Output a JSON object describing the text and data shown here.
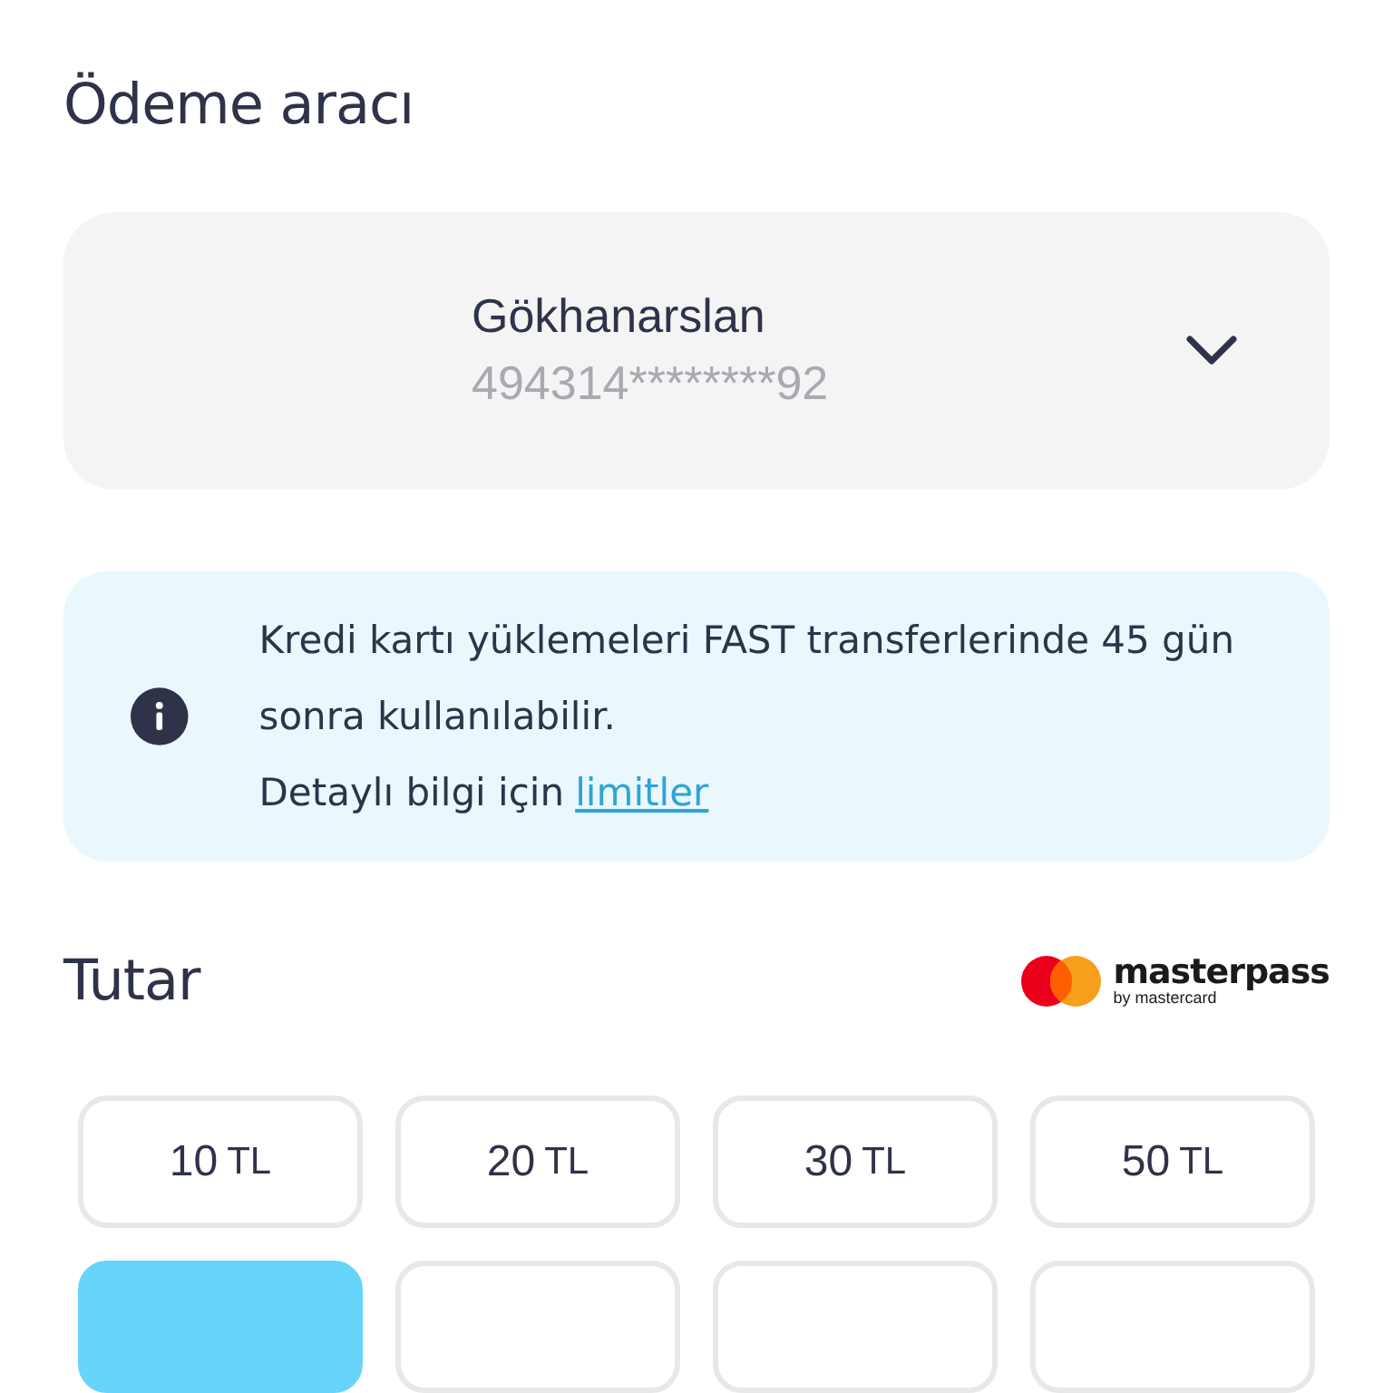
{
  "payment_method": {
    "title": "Ödeme aracı",
    "card": {
      "holder": "Gökhanarslan",
      "number": "494314********92"
    }
  },
  "notice": {
    "text": "Kredi kartı yüklemeleri FAST transferlerinde 45 gün sonra kullanılabilir.",
    "detail": "Detaylı bilgi için",
    "link": "limitler"
  },
  "amount": {
    "title": "Tutar",
    "provider": {
      "name": "masterpass",
      "tagline": "by mastercard"
    },
    "options": [
      {
        "amount": "10",
        "currency": "TL",
        "selected": false
      },
      {
        "amount": "20",
        "currency": "TL",
        "selected": false
      },
      {
        "amount": "30",
        "currency": "TL",
        "selected": false
      },
      {
        "amount": "50",
        "currency": "TL",
        "selected": false
      },
      {
        "selected": true
      },
      {
        "selected": false
      },
      {
        "selected": false
      },
      {
        "selected": false
      }
    ]
  }
}
